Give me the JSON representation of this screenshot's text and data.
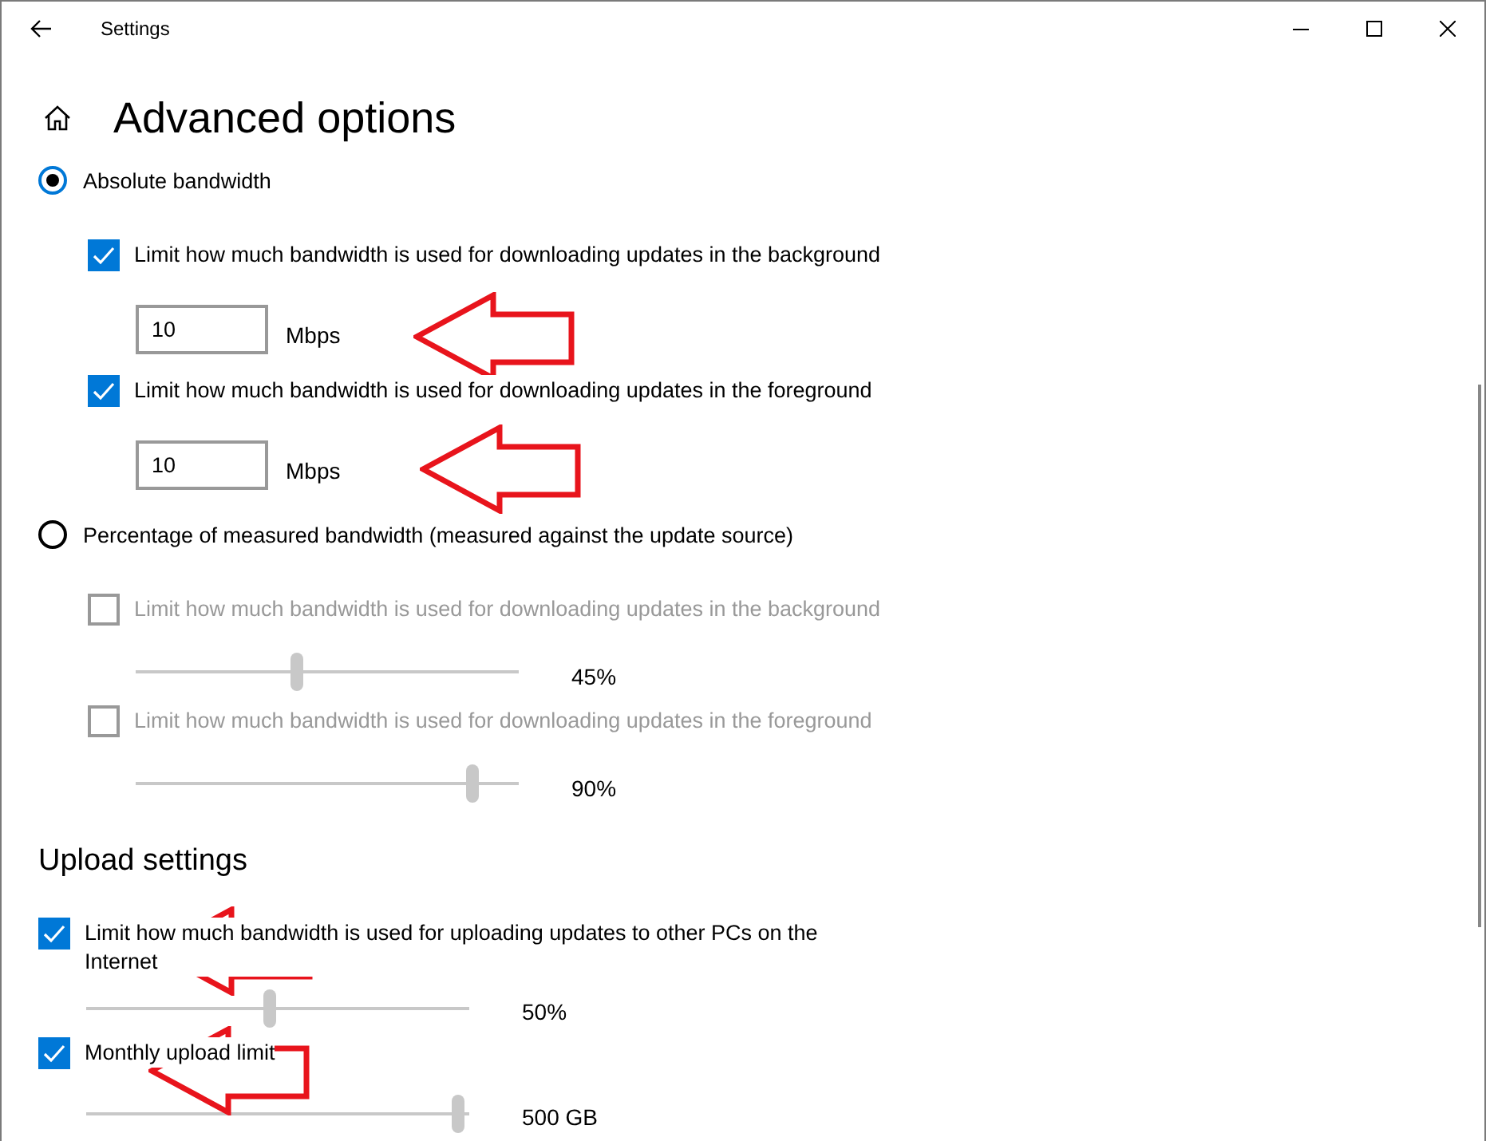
{
  "window": {
    "title": "Settings"
  },
  "page_title": "Advanced options",
  "bandwidth_modes": [
    {
      "label": "Absolute bandwidth",
      "selected": true,
      "limits": [
        {
          "kind": "field",
          "label": "Limit how much bandwidth is used for downloading updates in the background",
          "checked": true,
          "disabled": false,
          "value": "10",
          "unit": "Mbps"
        },
        {
          "kind": "field",
          "label": "Limit how much bandwidth is used for downloading updates in the foreground",
          "checked": true,
          "disabled": false,
          "value": "10",
          "unit": "Mbps"
        }
      ]
    },
    {
      "label": "Percentage of measured bandwidth (measured against the update source)",
      "selected": false,
      "limits": [
        {
          "kind": "slider",
          "label": "Limit how much bandwidth is used for downloading updates in the background",
          "checked": false,
          "disabled": true,
          "level": 0.42,
          "reading": "45%"
        },
        {
          "kind": "slider",
          "label": "Limit how much bandwidth is used for downloading updates in the foreground",
          "checked": false,
          "disabled": true,
          "level": 0.88,
          "reading": "90%"
        }
      ]
    }
  ],
  "upload": {
    "heading": "Upload settings",
    "limits": [
      {
        "kind": "slider",
        "label": "Limit how much bandwidth is used for uploading updates to other PCs on the Internet",
        "checked": true,
        "disabled": false,
        "level": 0.48,
        "reading": "50%"
      },
      {
        "kind": "slider",
        "label": "Monthly upload limit",
        "checked": true,
        "disabled": false,
        "level": 0.97,
        "reading": "500 GB"
      }
    ]
  }
}
